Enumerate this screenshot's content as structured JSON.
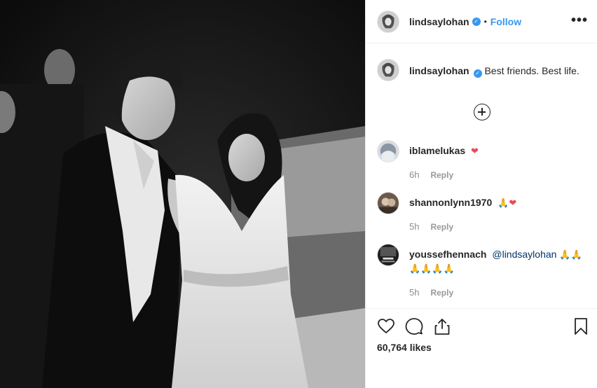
{
  "post": {
    "author": {
      "username": "lindsaylohan",
      "verified": true,
      "verified_symbol": "✓"
    },
    "header": {
      "separator": "•",
      "follow_label": "Follow",
      "more_label": "•••"
    },
    "caption": {
      "username": "lindsaylohan",
      "text": "Best friends. Best life."
    },
    "comments": [
      {
        "username": "iblamelukas",
        "text": "",
        "emoji": "❤",
        "emoji_kind": "heart",
        "time": "6h",
        "reply_label": "Reply"
      },
      {
        "username": "shannonlynn1970",
        "text": "",
        "emoji": "🙏",
        "emoji2": "❤",
        "time": "5h",
        "reply_label": "Reply"
      },
      {
        "username": "youssefhennach",
        "mention": "@lindsaylohan",
        "emoji_line1": "🙏🙏",
        "emoji_line2": "🙏🙏🙏🙏",
        "time": "5h",
        "reply_label": "Reply"
      }
    ],
    "likes": "60,764 likes",
    "icons": {
      "like": "heart-outline-icon",
      "comment": "speech-bubble-icon",
      "share": "share-icon",
      "save": "bookmark-icon",
      "load_more": "plus-circle-icon"
    },
    "colors": {
      "accent": "#3897f0",
      "text": "#262626",
      "muted": "#999999",
      "heart": "#ed4956"
    }
  }
}
